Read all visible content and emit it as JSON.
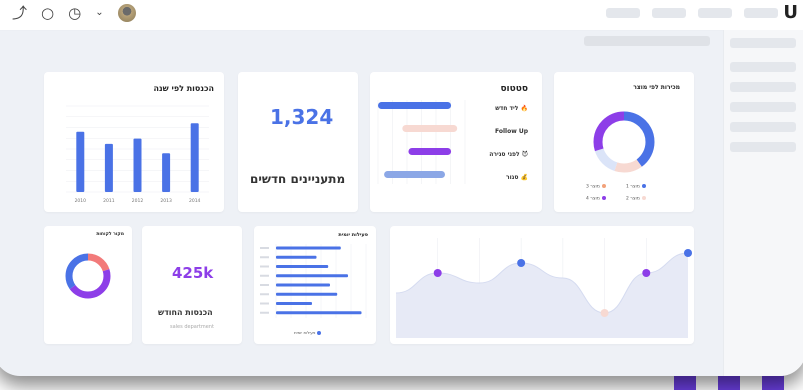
{
  "topbar": {
    "icons": [
      "reply-icon",
      "comment-icon",
      "clock-icon",
      "chevron-down-icon",
      "avatar"
    ]
  },
  "cards": {
    "annual_income": {
      "title": "הכנסות לפי שנה",
      "categories": [
        "2010",
        "2011",
        "2012",
        "2013",
        "2014"
      ],
      "values": [
        70,
        56,
        62,
        45,
        80
      ],
      "ylim": [
        0,
        100
      ],
      "color": "#4a72e6"
    },
    "new_leads": {
      "value": "1,324",
      "label": "מתעניינים חדשים",
      "color": "#4a72e6"
    },
    "status": {
      "title": "סטטוס",
      "rows": [
        {
          "label": "ליד חדש",
          "icon": "fire-icon",
          "color": "#4a72e6",
          "start": 0,
          "end": 60
        },
        {
          "label": "Follow Up",
          "icon": "",
          "color": "#f7d9d2",
          "start": 20,
          "end": 65
        },
        {
          "label": "לפני סגירה",
          "icon": "devil-icon",
          "color": "#8d3ee8",
          "start": 25,
          "end": 60
        },
        {
          "label": "סגור",
          "icon": "money-icon",
          "color": "#8ba7e6",
          "start": 5,
          "end": 55
        }
      ]
    },
    "sales_by_product": {
      "title": "מכירות לפי מוצר",
      "slices": [
        {
          "name": "מוצר 1",
          "value": 40,
          "color": "#4a72e6"
        },
        {
          "name": "מוצר 2",
          "value": 15,
          "color": "#f7d9d2"
        },
        {
          "name": "מוצר 3",
          "value": 15,
          "color": "#dbe4f8"
        },
        {
          "name": "מוצר 4",
          "value": 30,
          "color": "#8d3ee8"
        }
      ]
    },
    "customer_source": {
      "title": "מקור לקוחות",
      "slices": [
        {
          "value": 20,
          "color": "#f27a7a"
        },
        {
          "value": 45,
          "color": "#8d3ee8"
        },
        {
          "value": 35,
          "color": "#4a72e6"
        }
      ]
    },
    "monthly_income": {
      "value": "425k",
      "label": "הכנסות החודש",
      "sublabel": "sales department",
      "color": "#8d3ee8"
    },
    "daily_activity": {
      "title": "פעילות יומית",
      "values": [
        72,
        45,
        58,
        80,
        60,
        68,
        40,
        95
      ],
      "legend": "פעילות יומית"
    },
    "area_chart": {
      "values": [
        22,
        14,
        18,
        10,
        16,
        30,
        14,
        6
      ],
      "markers": [
        {
          "index": 1,
          "color": "#8d3ee8"
        },
        {
          "index": 3,
          "color": "#4a72e6"
        },
        {
          "index": 5,
          "color": "#f7d9d2"
        },
        {
          "index": 6,
          "color": "#8d3ee8"
        },
        {
          "index": 7,
          "color": "#4a72e6"
        }
      ]
    }
  }
}
